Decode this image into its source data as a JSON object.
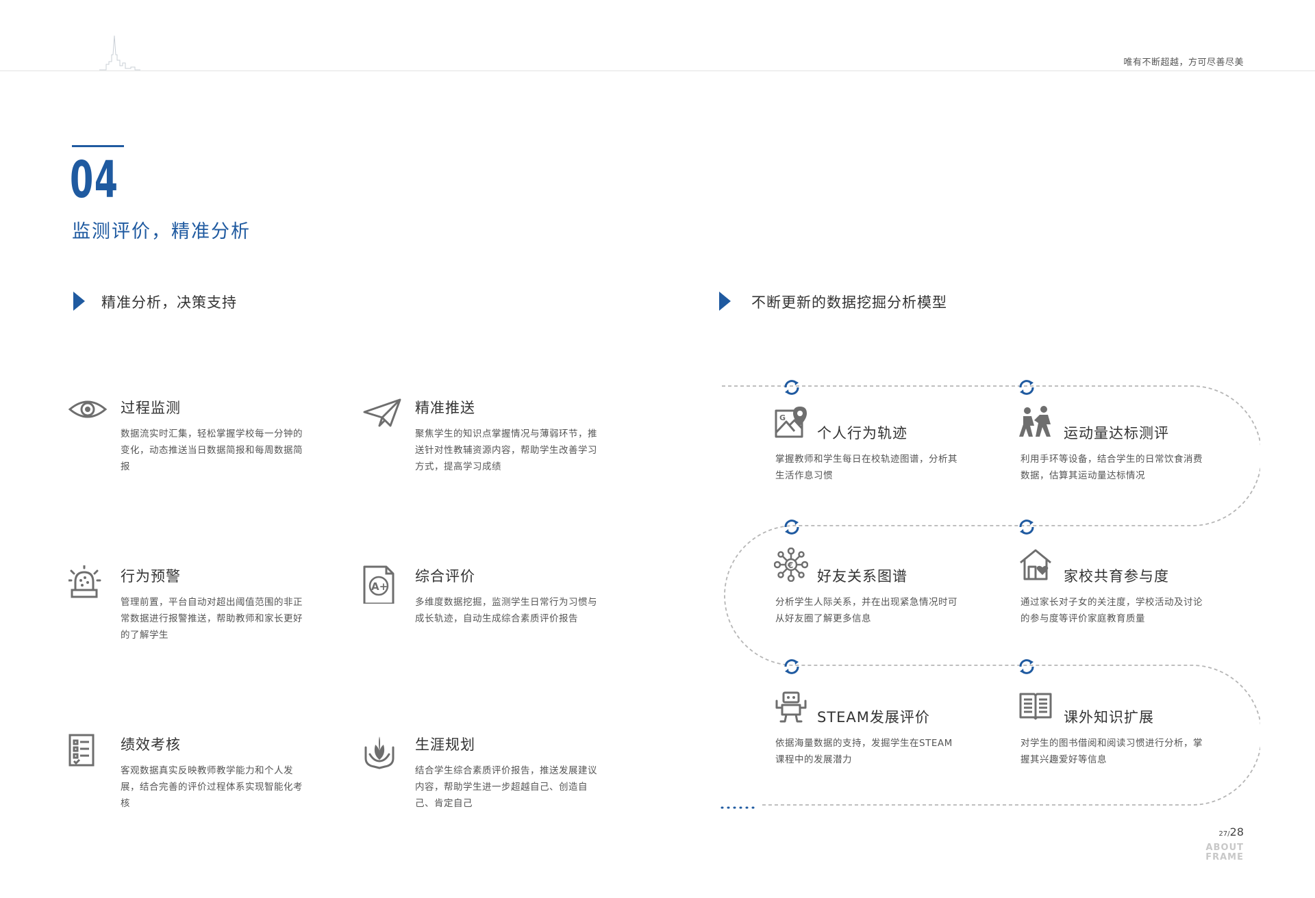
{
  "header": {
    "slogan": "唯有不断超越，方可尽善尽美"
  },
  "section": {
    "number": "04",
    "title": "监测评价，精准分析"
  },
  "left": {
    "heading": "精准分析，决策支持",
    "features": [
      {
        "title": "过程监测",
        "desc": "数据流实时汇集，轻松掌握学校每一分钟的变化，动态推送当日数据简报和每周数据简报",
        "icon": "eye-icon"
      },
      {
        "title": "精准推送",
        "desc": "聚焦学生的知识点掌握情况与薄弱环节，推送针对性教辅资源内容，帮助学生改善学习方式，提高学习成绩",
        "icon": "paper-plane-icon"
      },
      {
        "title": "行为预警",
        "desc": "管理前置，平台自动对超出阈值范围的非正常数据进行报警推送，帮助教师和家长更好的了解学生",
        "icon": "alarm-light-icon"
      },
      {
        "title": "综合评价",
        "desc": "多维度数据挖掘，监测学生日常行为习惯与成长轨迹，自动生成综合素质评价报告",
        "icon": "grade-document-icon"
      },
      {
        "title": "绩效考核",
        "desc": "客观数据真实反映教师教学能力和个人发展，结合完善的评价过程体系实现智能化考核",
        "icon": "checklist-icon"
      },
      {
        "title": "生涯规划",
        "desc": "结合学生综合素质评价报告，推送发展建议内容，帮助学生进一步超越自己、创造自己、肯定自己",
        "icon": "hands-plant-icon"
      }
    ]
  },
  "right": {
    "heading": "不断更新的数据挖掘分析模型",
    "models": [
      {
        "title": "个人行为轨迹",
        "desc": "掌握教师和学生每日在校轨迹图谱，分析其生活作息习惯",
        "icon": "map-pin-icon"
      },
      {
        "title": "运动量达标测评",
        "desc": "利用手环等设备，结合学生的日常饮食消费数据，估算其运动量达标情况",
        "icon": "people-exercise-icon"
      },
      {
        "title": "好友关系图谱",
        "desc": "分析学生人际关系，并在出现紧急情况时可从好友圈了解更多信息",
        "icon": "network-icon"
      },
      {
        "title": "家校共育参与度",
        "desc": "通过家长对子女的关注度，学校活动及讨论的参与度等评价家庭教育质量",
        "icon": "home-heart-icon"
      },
      {
        "title": "STEAM发展评价",
        "desc": "依据海量数据的支持，发掘学生在STEAM课程中的发展潜力",
        "icon": "robot-icon"
      },
      {
        "title": "课外知识扩展",
        "desc": "对学生的图书借阅和阅读习惯进行分析，掌握其兴趣爱好等信息",
        "icon": "open-book-icon"
      }
    ]
  },
  "footer": {
    "page_left": "27",
    "page_sep": "/",
    "page_right": "28",
    "brand_line1": "ABOUT",
    "brand_line2": "FRAME"
  },
  "colors": {
    "accent": "#1f5aa0",
    "icon_gray": "#6e6e6e",
    "dash": "#b5b5b5"
  }
}
